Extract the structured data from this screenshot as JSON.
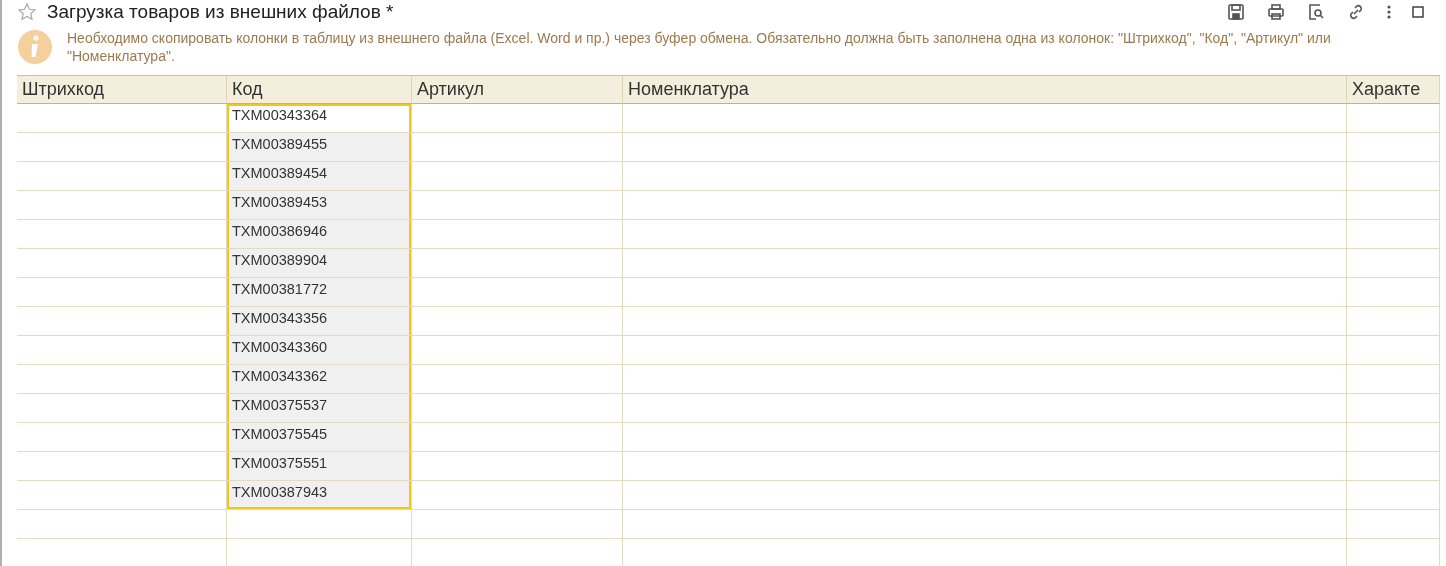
{
  "window": {
    "title": "Загрузка товаров из внешних файлов *",
    "favorite": false
  },
  "info": {
    "text": "Необходимо скопировать колонки в таблицу из внешнего файла (Excel. Word и пр.) через буфер обмена. Обязательно должна быть заполнена одна из колонок: \"Штрихкод\", \"Код\", \"Артикул\" или \"Номенклатура\"."
  },
  "table": {
    "columns": [
      "Штрихкод",
      "Код",
      "Артикул",
      "Номенклатура",
      "Характе"
    ],
    "rows": [
      {
        "code": "TXM00343364",
        "selected": true,
        "current": true
      },
      {
        "code": "TXM00389455",
        "selected": true,
        "current": false
      },
      {
        "code": "TXM00389454",
        "selected": true,
        "current": false
      },
      {
        "code": "TXM00389453",
        "selected": true,
        "current": false
      },
      {
        "code": "TXM00386946",
        "selected": true,
        "current": false
      },
      {
        "code": "TXM00389904",
        "selected": true,
        "current": false
      },
      {
        "code": "TXM00381772",
        "selected": true,
        "current": false
      },
      {
        "code": "TXM00343356",
        "selected": true,
        "current": false
      },
      {
        "code": "TXM00343360",
        "selected": true,
        "current": false
      },
      {
        "code": "TXM00343362",
        "selected": true,
        "current": false
      },
      {
        "code": "TXM00375537",
        "selected": true,
        "current": false
      },
      {
        "code": "TXM00375545",
        "selected": true,
        "current": false
      },
      {
        "code": "TXM00375551",
        "selected": true,
        "current": false
      },
      {
        "code": "TXM00387943",
        "selected": true,
        "current": false
      },
      {
        "selected": false
      },
      {
        "selected": false
      }
    ]
  }
}
